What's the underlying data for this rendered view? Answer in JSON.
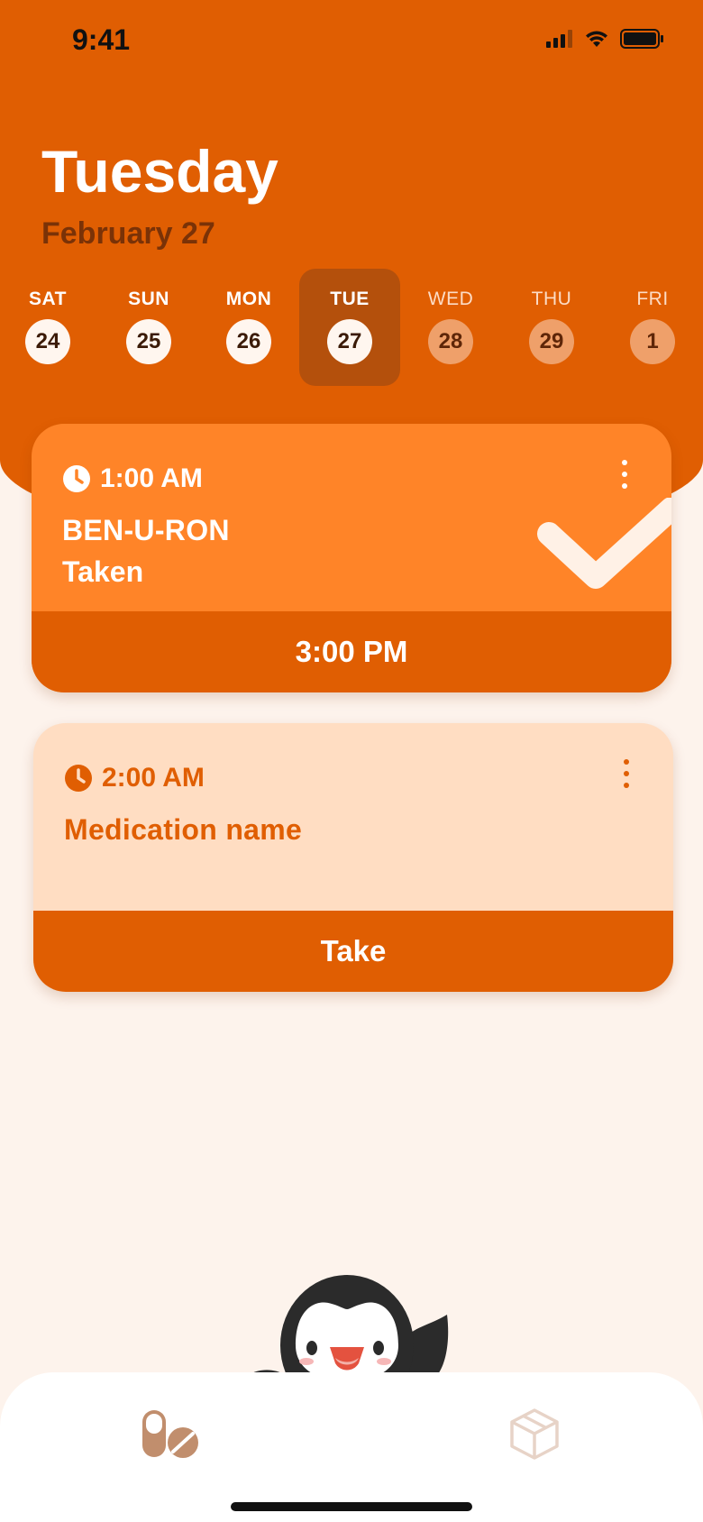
{
  "status_bar": {
    "time": "9:41"
  },
  "header": {
    "day_title": "Tuesday",
    "date_subtitle": "February 27"
  },
  "week": [
    {
      "label": "SAT",
      "date": "24",
      "state": "past"
    },
    {
      "label": "SUN",
      "date": "25",
      "state": "past"
    },
    {
      "label": "MON",
      "date": "26",
      "state": "past"
    },
    {
      "label": "TUE",
      "date": "27",
      "state": "selected"
    },
    {
      "label": "WED",
      "date": "28",
      "state": "future"
    },
    {
      "label": "THU",
      "date": "29",
      "state": "future"
    },
    {
      "label": "FRI",
      "date": "1",
      "state": "future"
    }
  ],
  "cards": [
    {
      "time": "1:00 AM",
      "name": "BEN-U-RON",
      "status": "Taken",
      "action": "3:00 PM"
    },
    {
      "time": "2:00 AM",
      "name": "Medication name",
      "status": "",
      "action": "Take"
    }
  ],
  "icons": {
    "signal": "cellular-signal-icon",
    "wifi": "wifi-icon",
    "battery": "battery-icon",
    "clock": "clock-icon",
    "menu": "more-vertical-icon",
    "check": "check-icon",
    "meds_tab": "pills-icon",
    "inventory_tab": "box-icon"
  },
  "colors": {
    "primary": "#E05E02",
    "card_taken": "#FF8428",
    "card_pending": "#FFDDC2",
    "background": "#FDF3EC"
  }
}
